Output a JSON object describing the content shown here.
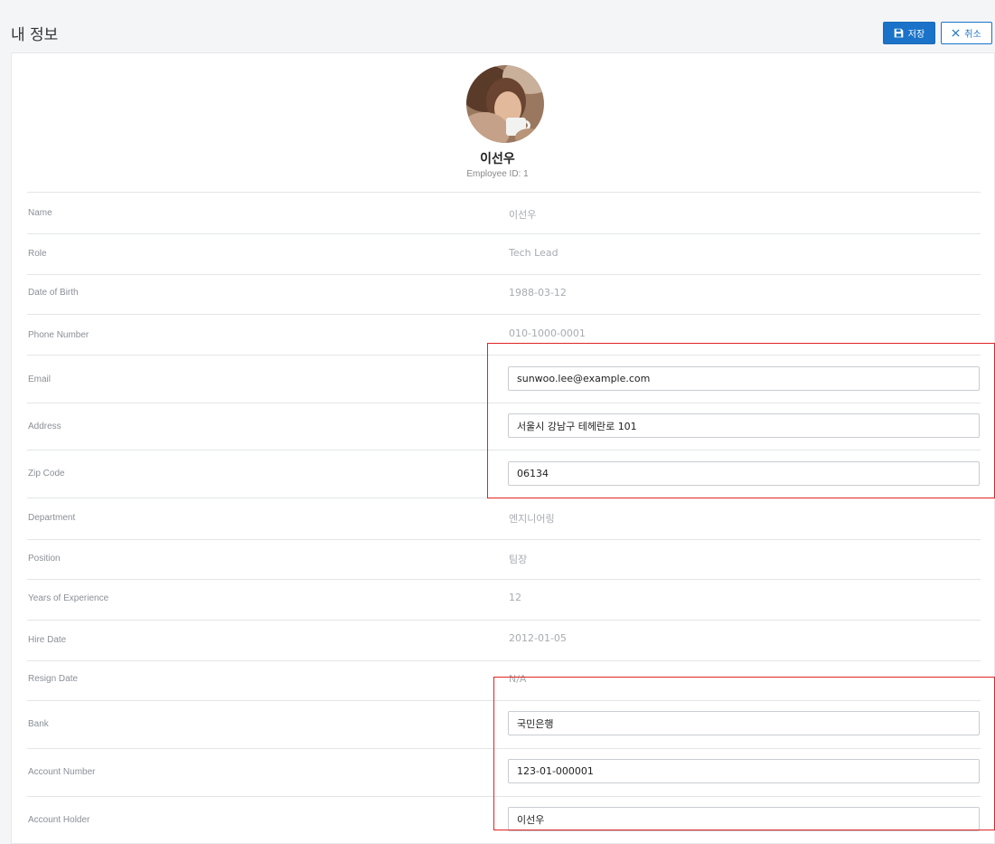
{
  "header": {
    "title": "내 정보",
    "save_label": "저장",
    "cancel_label": "취소"
  },
  "profile": {
    "name": "이선우",
    "employee_id": "Employee ID: 1"
  },
  "fields": {
    "name": {
      "label": "Name",
      "value": "이선우"
    },
    "role": {
      "label": "Role",
      "value": "Tech Lead"
    },
    "date_of_birth": {
      "label": "Date of Birth",
      "value": "1988-03-12"
    },
    "phone_number": {
      "label": "Phone Number",
      "value": "010-1000-0001"
    },
    "email": {
      "label": "Email",
      "value": "sunwoo.lee@example.com"
    },
    "address": {
      "label": "Address",
      "value": "서울시 강남구 테헤란로 101"
    },
    "zip_code": {
      "label": "Zip Code",
      "value": "06134"
    },
    "department": {
      "label": "Department",
      "value": "엔지니어링"
    },
    "position": {
      "label": "Position",
      "value": "팀장"
    },
    "years_experience": {
      "label": "Years of Experience",
      "value": "12"
    },
    "hire_date": {
      "label": "Hire Date",
      "value": "2012-01-05"
    },
    "resign_date": {
      "label": "Resign Date",
      "value": "N/A"
    },
    "bank": {
      "label": "Bank",
      "value": "국민은행"
    },
    "account_number": {
      "label": "Account Number",
      "value": "123-01-000001"
    },
    "account_holder": {
      "label": "Account Holder",
      "value": "이선우"
    }
  },
  "colors": {
    "primary": "#1a73c8",
    "highlight": "#e02424",
    "divider": "#e3e5e8"
  },
  "icons": {
    "save": "floppy-disk-icon",
    "cancel": "close-icon"
  }
}
